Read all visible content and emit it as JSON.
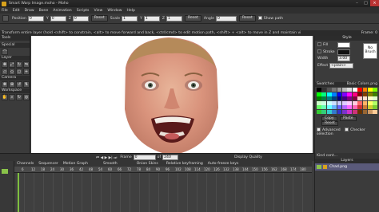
{
  "window": {
    "title": "Smart Warp Image.moho - Moho",
    "app_icon": "moho-app-icon"
  },
  "menu": [
    "File",
    "Edit",
    "Draw",
    "Bone",
    "Animation",
    "Scripts",
    "View",
    "Window",
    "Help"
  ],
  "options_bar": {
    "position_label": "Position",
    "pos_x": "0",
    "pos_y": "0",
    "pos_z": "0",
    "reset1": "Reset",
    "scale_label": "Scale",
    "scale_x": "1",
    "scale_y": "1",
    "scale_z": "1",
    "reset2": "Reset",
    "angle_label": "Angle",
    "angle_value": "0",
    "reset3": "Reset",
    "show_path": "Show path"
  },
  "hint": "Transform entire layer (hold <shift> to constrain, <alt> to move forward and back, <ctrl/cmd> to edit motion path, <shift> + <alt> to move in Z and maintain visual size)",
  "status_right": "Frame: 0",
  "left_panel": {
    "tools_header": "Tools",
    "special_header": "Special",
    "layer_header": "Layer",
    "camera_header": "Camera",
    "workspace_header": "Workspace"
  },
  "right_panel": {
    "style_header": "Style",
    "fill_label": "Fill",
    "stroke_label": "Stroke",
    "width_label": "Width",
    "width_value": "3.00",
    "no_brush": "No Brush",
    "effect_label": "Effect",
    "effect_value": "<plain>",
    "swatches_header": "Swatches",
    "swatches_set": "Basic Colors.png",
    "copy": "Copy",
    "paste": "Paste",
    "reset": "Reset",
    "advanced": "Advanced",
    "checker": "Checker selection",
    "layers_header": "Layers",
    "kind_label": "Kind cont...",
    "layer_name": "Chad.png",
    "swatch_colors": [
      "#000000",
      "#333333",
      "#555555",
      "#777777",
      "#999999",
      "#bbbbbb",
      "#dddddd",
      "#ffffff",
      "#ff0000",
      "#ff8000",
      "#ffff00",
      "#80ff00",
      "#00ff00",
      "#00ff80",
      "#00ffff",
      "#0080ff",
      "#0000ff",
      "#8000ff",
      "#ff00ff",
      "#ff0080",
      "#800000",
      "#804000",
      "#808000",
      "#408000",
      "#008000",
      "#008040",
      "#008080",
      "#004080",
      "#000080",
      "#400080",
      "#800080",
      "#800040",
      "#ffcccc",
      "#ffe0cc",
      "#ffffcc",
      "#e0ffcc",
      "#ccffcc",
      "#ccffe0",
      "#ccffff",
      "#cce0ff",
      "#ccccff",
      "#e0ccff",
      "#ffccff",
      "#ffcce0",
      "#ff6666",
      "#ffb366",
      "#ffff66",
      "#b3ff66",
      "#66ff66",
      "#66ffb3",
      "#66ffff",
      "#66b3ff",
      "#6666ff",
      "#b366ff",
      "#ff66ff",
      "#ff66b3",
      "#cc3333",
      "#cc7a33",
      "#cccc33",
      "#7acc33",
      "#33cc33",
      "#33cc7a",
      "#33cccc",
      "#337acc",
      "#3333cc",
      "#7a33cc",
      "#cc33cc",
      "#cc337a",
      "#663300",
      "#996633",
      "#cc9966",
      "#ffcc99"
    ]
  },
  "timeline": {
    "frame_label": "Frame",
    "frame_value": "0",
    "of_label": "of",
    "end_value": "240",
    "display_quality": "Display Quality",
    "tabs": [
      "Channels",
      "Sequencer",
      "Motion Graph"
    ],
    "smooth": "Smooth",
    "onion": "Onion Skins",
    "relative": "Relative keyframing",
    "autofreeze": "Auto-freeze keys",
    "ruler_ticks": [
      "6",
      "12",
      "18",
      "24",
      "30",
      "36",
      "42",
      "48",
      "54",
      "60",
      "66",
      "72",
      "78",
      "84",
      "90",
      "96",
      "102",
      "108",
      "114",
      "120",
      "126",
      "132",
      "138",
      "144",
      "150",
      "156",
      "162",
      "168",
      "174",
      "180"
    ]
  },
  "colors": {
    "accent": "#d9a21c",
    "canvas_bg": "#ffffff",
    "panel_bg": "#3b3b3b"
  }
}
